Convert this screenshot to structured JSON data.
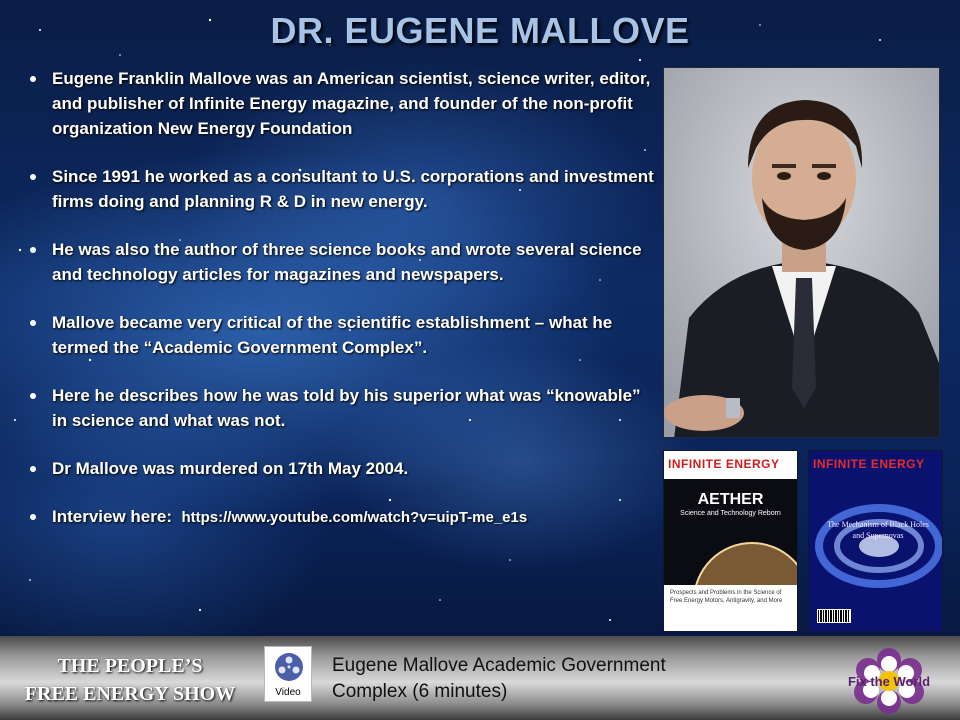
{
  "slide": {
    "title": "DR. EUGENE MALLOVE",
    "bullets": [
      "Eugene Franklin Mallove was an American scientist, science writer, editor, and publisher of Infinite Energy magazine, and founder of the non-profit organization New Energy Foundation",
      "Since 1991 he worked as a consultant to U.S. corporations and investment firms doing and planning R & D in new energy.",
      " He was also the author of three science books and wrote several science and technology articles for magazines and newspapers.",
      "Mallove became very critical of the scientific establishment – what he termed the  “Academic Government Complex”.",
      "Here he describes how he was told by his superior what was “knowable” in science and what was not.",
      "Dr Mallove was murdered on 17th May 2004."
    ],
    "interview_label": "Interview here:",
    "interview_url": "https://www.youtube.com/watch?v=uipT-me_e1s"
  },
  "covers": [
    {
      "masthead": "INFINITE ENERGY",
      "headline": "AETHER",
      "subhead": "Science and Technology Reborn",
      "blurb": "Prospects and Problems in the Science of Free Energy Motors, Antigravity, and More"
    },
    {
      "masthead": "INFINITE ENERGY",
      "headline": "The Mechanism of Black Holes and Supernovas"
    }
  ],
  "footer": {
    "show_name_line1": "THE PEOPLE’S",
    "show_name_line2": "FREE ENERGY SHOW",
    "video_icon_label": "Video",
    "video_caption_line1": "Eugene Mallove Academic Government",
    "video_caption_line2": "Complex (6 minutes)",
    "logo_text": "Fix the World"
  },
  "colors": {
    "title": "#a7c4e6",
    "text": "#ffffff",
    "background": "#0d2a63",
    "masthead_red": "#d21b1b"
  }
}
